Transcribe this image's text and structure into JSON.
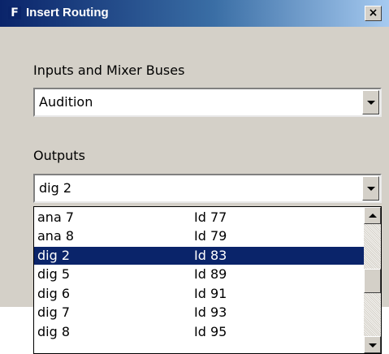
{
  "window": {
    "title": "Insert Routing",
    "app_icon_glyph": "F",
    "close_glyph": "×"
  },
  "inputs": {
    "label": "Inputs and Mixer Buses",
    "value": "Audition"
  },
  "outputs": {
    "label": "Outputs",
    "value": "dig 2",
    "list": [
      {
        "name": "ana 7",
        "id": "Id 77",
        "selected": false
      },
      {
        "name": "ana 8",
        "id": "Id 79",
        "selected": false
      },
      {
        "name": "dig 2",
        "id": "Id 83",
        "selected": true
      },
      {
        "name": "dig 5",
        "id": "Id 89",
        "selected": false
      },
      {
        "name": "dig 6",
        "id": "Id 91",
        "selected": false
      },
      {
        "name": "dig 7",
        "id": "Id 93",
        "selected": false
      },
      {
        "name": "dig 8",
        "id": "Id 95",
        "selected": false
      }
    ]
  },
  "colors": {
    "dialog_bg": "#d4d0c8",
    "selection": "#0a246a",
    "title_start": "#0a246a",
    "title_end": "#a6caf0"
  }
}
